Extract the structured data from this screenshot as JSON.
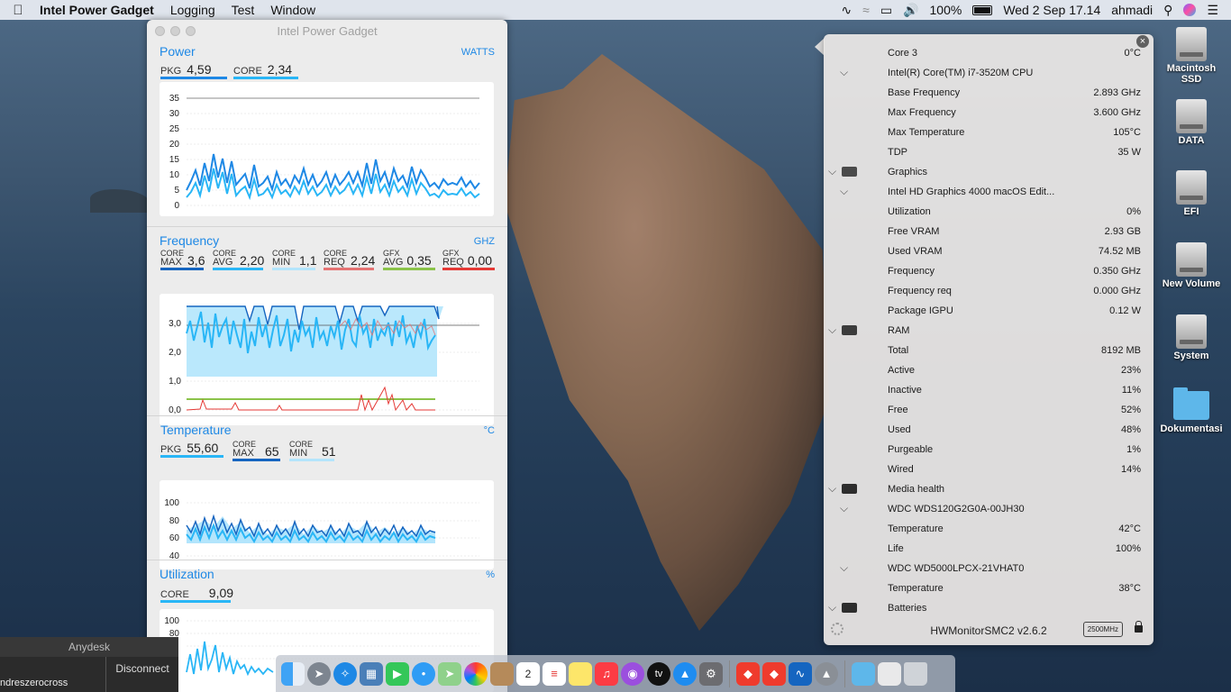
{
  "menubar": {
    "app_name": "Intel Power Gadget",
    "menus": [
      "Logging",
      "Test",
      "Window"
    ],
    "battery": "100%",
    "datetime": "Wed 2 Sep  17.14",
    "user": "ahmadi"
  },
  "ipg": {
    "title": "Intel Power Gadget",
    "power": {
      "title": "Power",
      "unit": "WATTS",
      "pkg_label": "PKG",
      "pkg_value": "4,59",
      "core_label": "CORE",
      "core_value": "2,34",
      "yticks": [
        "35",
        "30",
        "25",
        "20",
        "15",
        "10",
        "5",
        "0"
      ],
      "pkg_color": "#1e88e5",
      "core_color": "#29b6f6"
    },
    "frequency": {
      "title": "Frequency",
      "unit": "GHZ",
      "metrics": [
        {
          "top": "CORE",
          "bottom": "MAX",
          "value": "3,6",
          "color": "#1565c0"
        },
        {
          "top": "CORE",
          "bottom": "AVG",
          "value": "2,20",
          "color": "#29b6f6"
        },
        {
          "top": "CORE",
          "bottom": "MIN",
          "value": "1,1",
          "color": "#b3e5fc"
        },
        {
          "top": "CORE",
          "bottom": "REQ",
          "value": "2,24",
          "color": "#e57373"
        },
        {
          "top": "GFX",
          "bottom": "AVG",
          "value": "0,35",
          "color": "#8bc34a"
        },
        {
          "top": "GFX",
          "bottom": "REQ",
          "value": "0,00",
          "color": "#e53935"
        }
      ],
      "yticks": [
        "3,0",
        "2,0",
        "1,0",
        "0,0"
      ]
    },
    "temperature": {
      "title": "Temperature",
      "unit": "°C",
      "pkg_label": "PKG",
      "pkg_value": "55,60",
      "max_top": "CORE",
      "max_bottom": "MAX",
      "max_value": "65",
      "min_top": "CORE",
      "min_bottom": "MIN",
      "min_value": "51",
      "yticks": [
        "100",
        "80",
        "60",
        "40"
      ]
    },
    "utilization": {
      "title": "Utilization",
      "unit": "%",
      "core_label": "CORE",
      "core_value": "9,09",
      "yticks": [
        "100",
        "80"
      ]
    }
  },
  "anydesk": {
    "title": "Anydesk",
    "user": "ndreszerocross",
    "disconnect": "Disconnect"
  },
  "dock": {
    "icons": [
      "finder-icon",
      "launchpad-icon",
      "safari-icon",
      "preview-icon",
      "facetime-icon",
      "messages-icon",
      "maps-icon",
      "photos-icon",
      "contacts-icon",
      "calendar-icon",
      "reminders-icon",
      "notes-icon",
      "music-icon",
      "podcasts-icon",
      "tv-icon",
      "app-store-icon",
      "system-preferences-icon",
      "anydesk-icon",
      "anydesk-alt-icon",
      "power-gadget-icon",
      "hwmonitor-icon",
      "downloads-folder-icon",
      "documents-stack-icon",
      "trash-icon"
    ],
    "calendar_day": "2",
    "tv_label": "tv"
  },
  "hwm": {
    "footer": "HWMonitorSMC2 v2.6.2",
    "mhz": "2500MHz",
    "rows": [
      {
        "name": "Core 3",
        "value": "0°C",
        "indent": 2
      },
      {
        "name": "Intel(R) Core(TM) i7-3520M CPU",
        "value": "",
        "indent": 1
      },
      {
        "name": "Base Frequency",
        "value": "2.893 GHz",
        "indent": 2
      },
      {
        "name": "Max Frequency",
        "value": "3.600 GHz",
        "indent": 2
      },
      {
        "name": "Max Temperature",
        "value": "105°C",
        "indent": 2
      },
      {
        "name": "TDP",
        "value": "35 W",
        "indent": 2
      },
      {
        "name": "Graphics",
        "value": "",
        "indent": 0,
        "icon": "graphics-icon"
      },
      {
        "name": "Intel HD Graphics 4000 macOS Edit...",
        "value": "",
        "indent": 1
      },
      {
        "name": "Utilization",
        "value": "0%",
        "indent": 2
      },
      {
        "name": "Free VRAM",
        "value": "2.93 GB",
        "indent": 2
      },
      {
        "name": "Used VRAM",
        "value": "74.52 MB",
        "indent": 2
      },
      {
        "name": "Frequency",
        "value": "0.350 GHz",
        "indent": 2
      },
      {
        "name": "Frequency req",
        "value": "0.000 GHz",
        "indent": 2
      },
      {
        "name": "Package IGPU",
        "value": "0.12 W",
        "indent": 2
      },
      {
        "name": "RAM",
        "value": "",
        "indent": 0,
        "icon": "ram-icon"
      },
      {
        "name": "Total",
        "value": "8192 MB",
        "indent": 2
      },
      {
        "name": "Active",
        "value": "23%",
        "indent": 2
      },
      {
        "name": "Inactive",
        "value": "11%",
        "indent": 2
      },
      {
        "name": "Free",
        "value": "52%",
        "indent": 2
      },
      {
        "name": "Used",
        "value": "48%",
        "indent": 2
      },
      {
        "name": "Purgeable",
        "value": "1%",
        "indent": 2
      },
      {
        "name": "Wired",
        "value": "14%",
        "indent": 2
      },
      {
        "name": "Media health",
        "value": "",
        "indent": 0,
        "icon": "disk-icon"
      },
      {
        "name": "WDC WDS120G2G0A-00JH30",
        "value": "",
        "indent": 1
      },
      {
        "name": "Temperature",
        "value": "42°C",
        "indent": 2
      },
      {
        "name": "Life",
        "value": "100%",
        "indent": 2
      },
      {
        "name": "WDC WD5000LPCX-21VHAT0",
        "value": "",
        "indent": 1
      },
      {
        "name": "Temperature",
        "value": "38°C",
        "indent": 2
      },
      {
        "name": "Batteries",
        "value": "",
        "indent": 0,
        "icon": "battery-icon"
      }
    ]
  },
  "desktop": {
    "icons": [
      {
        "label": "Macintosh SSD",
        "kind": "drive"
      },
      {
        "label": "DATA",
        "kind": "drive"
      },
      {
        "label": "EFI",
        "kind": "drive"
      },
      {
        "label": "New Volume",
        "kind": "drive"
      },
      {
        "label": "System",
        "kind": "drive"
      },
      {
        "label": "Dokumentasi",
        "kind": "folder"
      }
    ]
  }
}
